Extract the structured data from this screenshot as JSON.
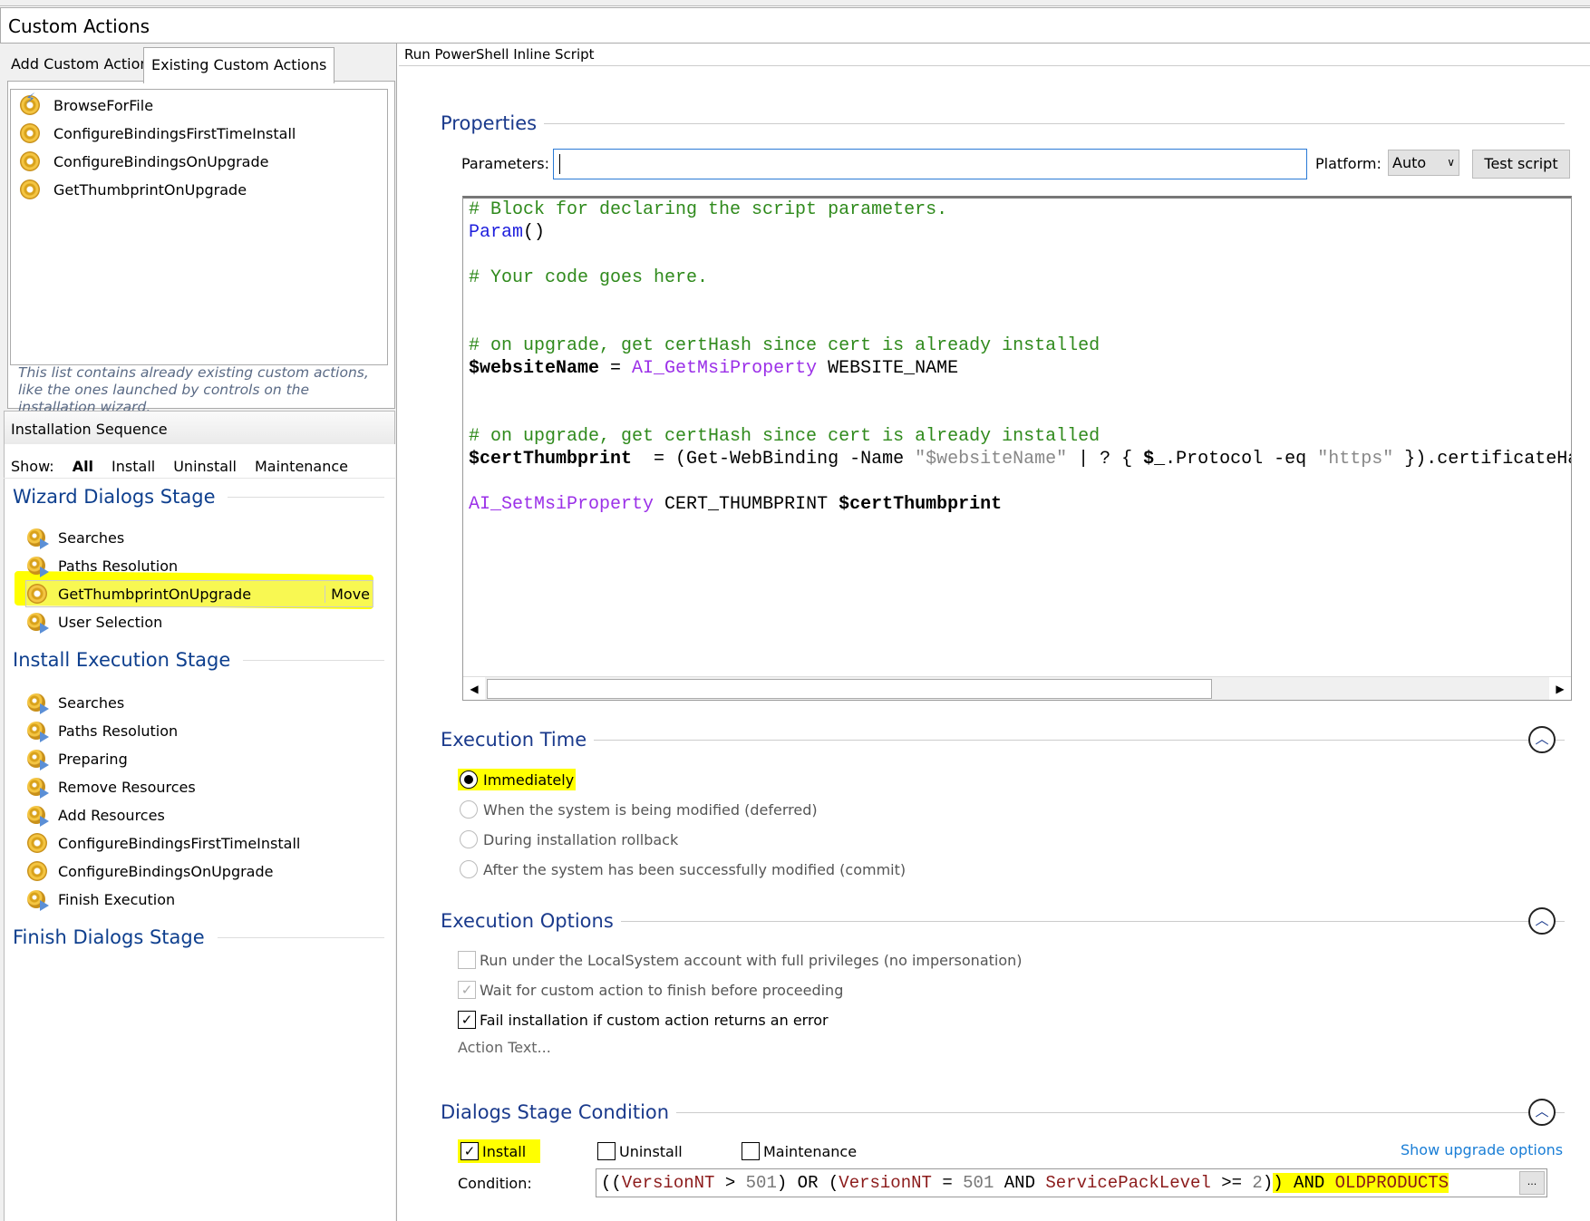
{
  "header": {
    "title": "Custom Actions"
  },
  "left": {
    "tabs": [
      {
        "label": "Add Custom Action",
        "active": false
      },
      {
        "label": "Existing Custom Actions",
        "active": true
      }
    ],
    "custom_actions": [
      {
        "label": "BrowseForFile",
        "icon": "gear-lightning-icon"
      },
      {
        "label": "ConfigureBindingsFirstTimeInstall",
        "icon": "gear-icon"
      },
      {
        "label": "ConfigureBindingsOnUpgrade",
        "icon": "gear-icon"
      },
      {
        "label": "GetThumbprintOnUpgrade",
        "icon": "gear-icon"
      }
    ],
    "note": "This list contains already existing custom actions, like the ones launched by controls on the installation wizard.",
    "sequence_title": "Installation Sequence",
    "show": {
      "label": "Show:",
      "options": [
        "All",
        "Install",
        "Uninstall",
        "Maintenance"
      ],
      "selected": "All"
    },
    "stages": [
      {
        "title": "Wizard Dialogs Stage",
        "items": [
          {
            "label": "Searches",
            "icon": "sequence-step-icon"
          },
          {
            "label": "Paths Resolution",
            "icon": "sequence-step-icon"
          },
          {
            "label": "GetThumbprintOnUpgrade",
            "icon": "gear-icon",
            "selected": true,
            "action": "Move"
          },
          {
            "label": "User Selection",
            "icon": "sequence-step-icon"
          }
        ]
      },
      {
        "title": "Install Execution Stage",
        "items": [
          {
            "label": "Searches",
            "icon": "sequence-step-icon"
          },
          {
            "label": "Paths Resolution",
            "icon": "sequence-step-icon"
          },
          {
            "label": "Preparing",
            "icon": "sequence-step-icon"
          },
          {
            "label": "Remove Resources",
            "icon": "sequence-step-icon"
          },
          {
            "label": "Add Resources",
            "icon": "sequence-step-icon"
          },
          {
            "label": "ConfigureBindingsFirstTimeInstall",
            "icon": "gear-icon"
          },
          {
            "label": "ConfigureBindingsOnUpgrade",
            "icon": "gear-icon"
          },
          {
            "label": "Finish Execution",
            "icon": "sequence-step-icon"
          }
        ]
      },
      {
        "title": "Finish Dialogs Stage",
        "items": []
      }
    ]
  },
  "right": {
    "title": "Run PowerShell Inline Script",
    "properties": {
      "title": "Properties",
      "parameters_label": "Parameters:",
      "parameters_value": "",
      "platform_label": "Platform:",
      "platform_value": "Auto",
      "test_button": "Test script",
      "code": [
        [
          {
            "t": "# Block for declaring the script parameters.",
            "k": "comment"
          }
        ],
        [
          {
            "t": "Param",
            "k": "kw"
          },
          {
            "t": "()",
            "k": "plain"
          }
        ],
        [],
        [
          {
            "t": "# Your code goes here.",
            "k": "comment"
          }
        ],
        [],
        [],
        [
          {
            "t": "# on upgrade, get certHash since cert is already installed",
            "k": "comment"
          }
        ],
        [
          {
            "t": "$websiteName",
            "k": "var"
          },
          {
            "t": " = ",
            "k": "plain"
          },
          {
            "t": "AI_GetMsiProperty",
            "k": "fn"
          },
          {
            "t": " WEBSITE_NAME",
            "k": "plain"
          }
        ],
        [],
        [],
        [
          {
            "t": "# on upgrade, get certHash since cert is already installed",
            "k": "comment"
          }
        ],
        [
          {
            "t": "$certThumbprint",
            "k": "var"
          },
          {
            "t": "  = (Get-WebBinding -Name ",
            "k": "plain"
          },
          {
            "t": "\"$websiteName\"",
            "k": "str"
          },
          {
            "t": " | ? { ",
            "k": "plain"
          },
          {
            "t": "$_",
            "k": "var"
          },
          {
            "t": ".Protocol -eq ",
            "k": "plain"
          },
          {
            "t": "\"https\"",
            "k": "str"
          },
          {
            "t": " }).certificateHash",
            "k": "plain"
          }
        ],
        [],
        [
          {
            "t": "AI_SetMsiProperty",
            "k": "fn"
          },
          {
            "t": " CERT_THUMBPRINT ",
            "k": "plain"
          },
          {
            "t": "$certThumbprint",
            "k": "var"
          }
        ]
      ]
    },
    "execution_time": {
      "title": "Execution Time",
      "options": [
        {
          "label": "Immediately",
          "selected": true
        },
        {
          "label": "When the system is being modified (deferred)",
          "selected": false
        },
        {
          "label": "During installation rollback",
          "selected": false
        },
        {
          "label": "After the system has been successfully modified (commit)",
          "selected": false
        }
      ]
    },
    "execution_options": {
      "title": "Execution Options",
      "options": [
        {
          "label": "Run under the LocalSystem account with full privileges (no impersonation)",
          "checked": false,
          "enabled": false
        },
        {
          "label": "Wait for custom action to finish before proceeding",
          "checked": true,
          "enabled": false
        },
        {
          "label": "Fail installation if custom action returns an error",
          "checked": true,
          "enabled": true
        }
      ],
      "action_text": "Action Text..."
    },
    "dialogs_condition": {
      "title": "Dialogs Stage Condition",
      "checks": [
        {
          "label": "Install",
          "checked": true
        },
        {
          "label": "Uninstall",
          "checked": false
        },
        {
          "label": "Maintenance",
          "checked": false
        }
      ],
      "upgrade_link": "Show upgrade options",
      "condition_label": "Condition:",
      "condition": [
        {
          "t": "((",
          "k": "op"
        },
        {
          "t": "VersionNT",
          "k": "prop"
        },
        {
          "t": " > ",
          "k": "op"
        },
        {
          "t": "501",
          "k": "num"
        },
        {
          "t": ") OR (",
          "k": "op"
        },
        {
          "t": "VersionNT",
          "k": "prop"
        },
        {
          "t": " = ",
          "k": "op"
        },
        {
          "t": "501",
          "k": "num"
        },
        {
          "t": " AND ",
          "k": "op"
        },
        {
          "t": "ServicePackLevel",
          "k": "prop"
        },
        {
          "t": " >= ",
          "k": "op"
        },
        {
          "t": "2",
          "k": "num"
        },
        {
          "t": ")",
          "k": "op"
        },
        {
          "t": ") AND ",
          "k": "op",
          "hl": true
        },
        {
          "t": "OLDPRODUCTS",
          "k": "prop",
          "hl": true
        }
      ],
      "browse_button": "..."
    }
  },
  "colors": {
    "highlight": "#ffff00",
    "section_title": "#1a3a8c",
    "link": "#1a7ed6"
  }
}
